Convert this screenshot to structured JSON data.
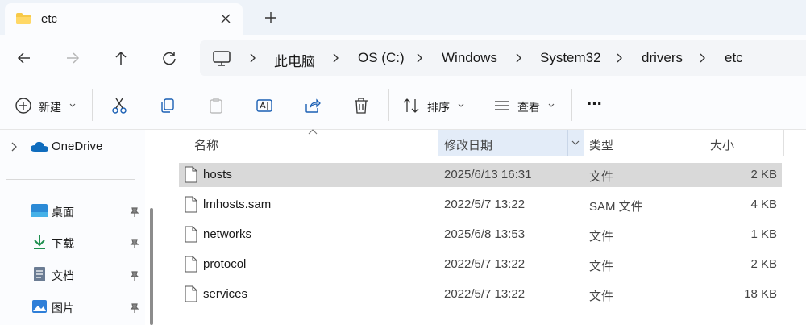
{
  "tab": {
    "title": "etc"
  },
  "address": {
    "crumbs": [
      "此电脑",
      "OS (C:)",
      "Windows",
      "System32",
      "drivers",
      "etc"
    ]
  },
  "toolbar": {
    "new_label": "新建",
    "sort_label": "排序",
    "view_label": "查看",
    "more_label": "···"
  },
  "sidebar": {
    "onedrive": "OneDrive",
    "items": [
      {
        "label": "桌面",
        "icon": "desktop-icon"
      },
      {
        "label": "下载",
        "icon": "download-icon"
      },
      {
        "label": "文档",
        "icon": "document-icon"
      },
      {
        "label": "图片",
        "icon": "picture-icon"
      }
    ]
  },
  "columns": {
    "name": "名称",
    "date": "修改日期",
    "type": "类型",
    "size": "大小"
  },
  "files": [
    {
      "name": "hosts",
      "date": "2025/6/13 16:31",
      "type": "文件",
      "size": "2 KB",
      "selected": true
    },
    {
      "name": "lmhosts.sam",
      "date": "2022/5/7 13:22",
      "type": "SAM 文件",
      "size": "4 KB"
    },
    {
      "name": "networks",
      "date": "2025/6/8 13:53",
      "type": "文件",
      "size": "1 KB"
    },
    {
      "name": "protocol",
      "date": "2022/5/7 13:22",
      "type": "文件",
      "size": "2 KB"
    },
    {
      "name": "services",
      "date": "2022/5/7 13:22",
      "type": "文件",
      "size": "18 KB"
    }
  ],
  "colors": {
    "accent": "#0067c0",
    "selected_row": "#d9d9d9",
    "sorted_header": "#e3ecf8"
  }
}
